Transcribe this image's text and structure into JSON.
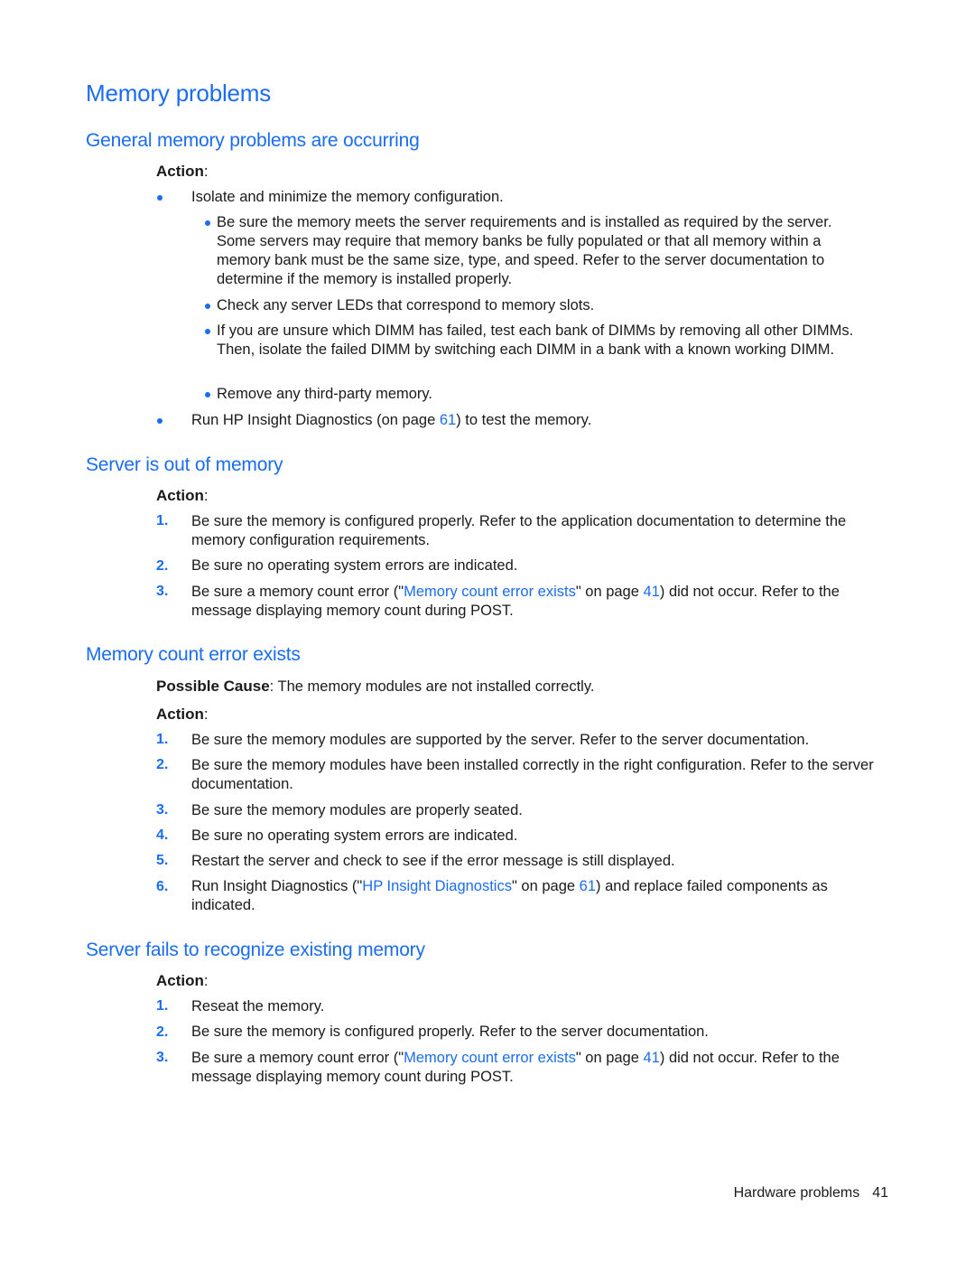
{
  "page": {
    "title": "Memory problems",
    "footer": {
      "section": "Hardware problems",
      "page_number": "41"
    }
  },
  "theme": {
    "accent": "#1a6cf0",
    "text": "#1a1a1a"
  },
  "sections": [
    {
      "heading": "General memory problems are occurring",
      "action_label": "Action",
      "bullets": [
        {
          "text": "Isolate and minimize the memory configuration."
        },
        {
          "text": "Be sure the memory meets the server requirements and is installed as required by the server. Some servers may require that memory banks be fully populated or that all memory within a memory bank must be the same size, type, and speed. Refer to the server documentation to determine if the memory is installed properly."
        },
        {
          "text": "Check any server LEDs that correspond to memory slots."
        },
        {
          "text": "If you are unsure which DIMM has failed, test each bank of DIMMs by removing all other DIMMs. Then, isolate the failed DIMM by switching each DIMM in a bank with a known working DIMM."
        },
        {
          "text": "Remove any third-party memory."
        },
        {
          "before": "Run HP Insight Diagnostics (on page ",
          "link": "61",
          "after": ") to test the memory."
        }
      ]
    },
    {
      "heading": "Server is out of memory",
      "action_label": "Action",
      "steps": [
        {
          "num": "1.",
          "text": "Be sure the memory is configured properly. Refer to the application documentation to determine the memory configuration requirements."
        },
        {
          "num": "2.",
          "text": "Be sure no operating system errors are indicated."
        },
        {
          "num": "3.",
          "before": "Be sure a memory count error (\"",
          "link": "Memory count error exists",
          "middle": "\" on page ",
          "link2": "41",
          "after": ") did not occur. Refer to the message displaying memory count during POST."
        }
      ]
    },
    {
      "heading": "Memory count error exists",
      "cause_label": "Possible Cause",
      "cause_text": ": The memory modules are not installed correctly.",
      "action_label": "Action",
      "steps": [
        {
          "num": "1.",
          "text": "Be sure the memory modules are supported by the server. Refer to the server documentation."
        },
        {
          "num": "2.",
          "text": "Be sure the memory modules have been installed correctly in the right configuration. Refer to the server documentation."
        },
        {
          "num": "3.",
          "text": "Be sure the memory modules are properly seated."
        },
        {
          "num": "4.",
          "text": "Be sure no operating system errors are indicated."
        },
        {
          "num": "5.",
          "text": "Restart the server and check to see if the error message is still displayed."
        },
        {
          "num": "6.",
          "before": "Run Insight Diagnostics (\"",
          "link": "HP Insight Diagnostics",
          "middle": "\" on page ",
          "link2": "61",
          "after": ") and replace failed components as indicated."
        }
      ]
    },
    {
      "heading": "Server fails to recognize existing memory",
      "action_label": "Action",
      "steps": [
        {
          "num": "1.",
          "text": "Reseat the memory."
        },
        {
          "num": "2.",
          "text": "Be sure the memory is configured properly. Refer to the server documentation."
        },
        {
          "num": "3.",
          "before": "Be sure a memory count error (\"",
          "link": "Memory count error exists",
          "middle": "\" on page ",
          "link2": "41",
          "after": ") did not occur. Refer to the message displaying memory count during POST."
        }
      ]
    }
  ]
}
